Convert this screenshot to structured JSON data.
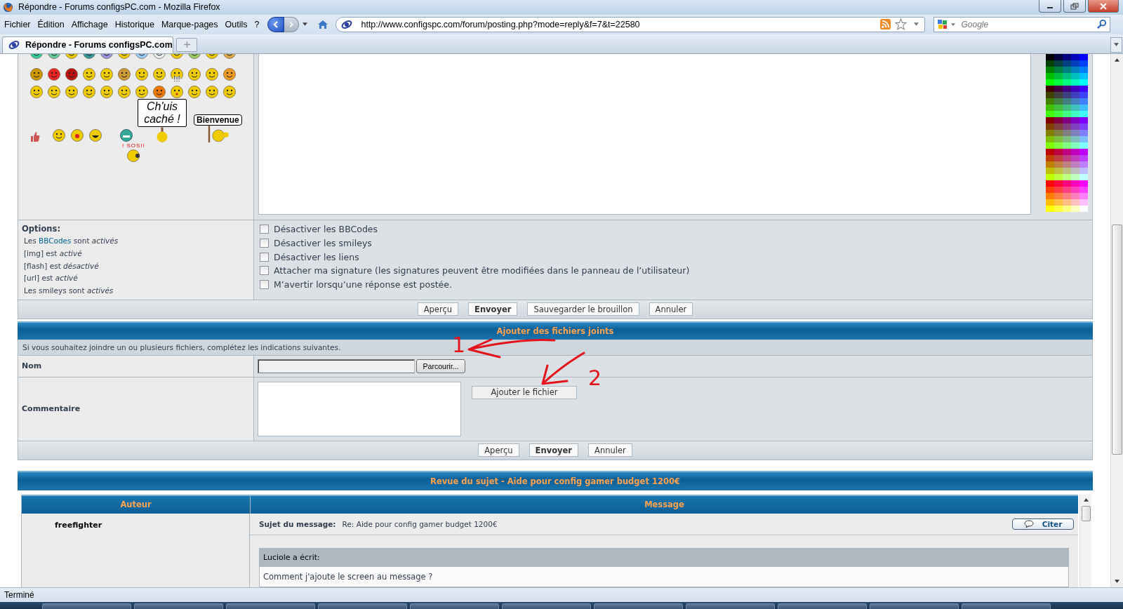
{
  "window": {
    "title": "Répondre - Forums configsPC.com - Mozilla Firefox"
  },
  "menu": [
    "Fichier",
    "Édition",
    "Affichage",
    "Historique",
    "Marque-pages",
    "Outils",
    "?"
  ],
  "address": {
    "url": "http://www.configspc.com/forum/posting.php?mode=reply&f=7&t=22580"
  },
  "search": {
    "placeholder": "Google"
  },
  "tabs": [
    {
      "label": "Répondre - Forums configsPC.com",
      "selected": true
    }
  ],
  "smilies": {
    "alarm": "!!!",
    "hidden_sign": "Ch'uis caché !",
    "welcome_sign": "Bienvenue",
    "sos_sign": "! SOS!!"
  },
  "options": {
    "title": "Options:",
    "lines": [
      {
        "before": "Les ",
        "link": "BBCodes",
        "after": " sont *activés*"
      },
      {
        "before": "[img] est *activé*"
      },
      {
        "before": "[flash] est *désactivé*"
      },
      {
        "before": "[url] est *activé*"
      },
      {
        "before": "Les smileys sont *activés*"
      }
    ]
  },
  "checkboxes": [
    {
      "label": "Désactiver les BBCodes",
      "checked": false
    },
    {
      "label": "Désactiver les smileys",
      "checked": false
    },
    {
      "label": "Désactiver les liens",
      "checked": false
    },
    {
      "label": "Attacher ma signature (les signatures peuvent être modifiées dans le panneau de l’utilisateur)",
      "checked": false
    },
    {
      "label": "M’avertir lorsqu’une réponse est postée.",
      "checked": false
    }
  ],
  "buttons": [
    {
      "label": "Aperçu",
      "primary": false
    },
    {
      "label": "Envoyer",
      "primary": true
    },
    {
      "label": "Sauvegarder le brouillon",
      "primary": false
    },
    {
      "label": "Annuler",
      "primary": false
    }
  ],
  "attachments": {
    "title": "Ajouter des fichiers joints",
    "hint": "Si vous souhaitez joindre un ou plusieurs fichiers, complétez les indications suivantes.",
    "name_label": "Nom",
    "browse_button": "Parcourir...",
    "comment_label": "Commentaire",
    "add_button": "Ajouter le fichier",
    "buttons": [
      {
        "label": "Aperçu",
        "primary": false
      },
      {
        "label": "Envoyer",
        "primary": true
      },
      {
        "label": "Annuler",
        "primary": false
      }
    ]
  },
  "annotations": [
    {
      "label": "1"
    },
    {
      "label": "2"
    }
  ],
  "review": {
    "title": "Revue du sujet - Aide pour config gamer budget 1200€",
    "columns": [
      "Auteur",
      "Message"
    ],
    "posts": [
      {
        "author": "freefighter",
        "subject_label": "Sujet du message:",
        "subject": "Re: Aide pour config gamer budget 1200€",
        "quote_button": "Citer",
        "quote_author": "Luciole a écrit:",
        "quote_text": "Comment j'ajoute le screen au message ?"
      }
    ]
  },
  "status_bar": "Terminé"
}
